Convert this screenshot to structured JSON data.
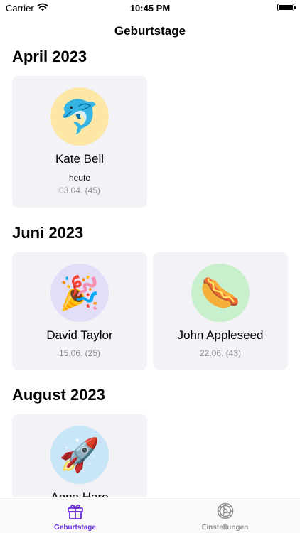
{
  "status_bar": {
    "carrier": "Carrier",
    "time": "10:45 PM"
  },
  "nav": {
    "title": "Geburtstage"
  },
  "sections": [
    {
      "title": "April 2023",
      "cards": [
        {
          "name": "Kate Bell",
          "subtitle": "heute",
          "date": "03.04. (45)",
          "emoji": "🐬",
          "avatar_color": "#fde7a6"
        }
      ]
    },
    {
      "title": "Juni 2023",
      "cards": [
        {
          "name": "David Taylor",
          "date": "15.06. (25)",
          "emoji": "🎉",
          "avatar_color": "#e3ddf8"
        },
        {
          "name": "John Appleseed",
          "date": "22.06. (43)",
          "emoji": "🌭",
          "avatar_color": "#c8f0cc"
        }
      ]
    },
    {
      "title": "August 2023",
      "cards": [
        {
          "name": "Anna Haro",
          "emoji": "🚀",
          "avatar_color": "#c8e6f8"
        }
      ]
    }
  ],
  "tab_bar": {
    "tabs": [
      {
        "label": "Geburtstage",
        "icon": "gift-icon",
        "selected": true,
        "color": "#6a2fd6"
      },
      {
        "label": "Einstellungen",
        "icon": "gear-icon",
        "selected": false,
        "color": "#8e8e93"
      }
    ]
  }
}
